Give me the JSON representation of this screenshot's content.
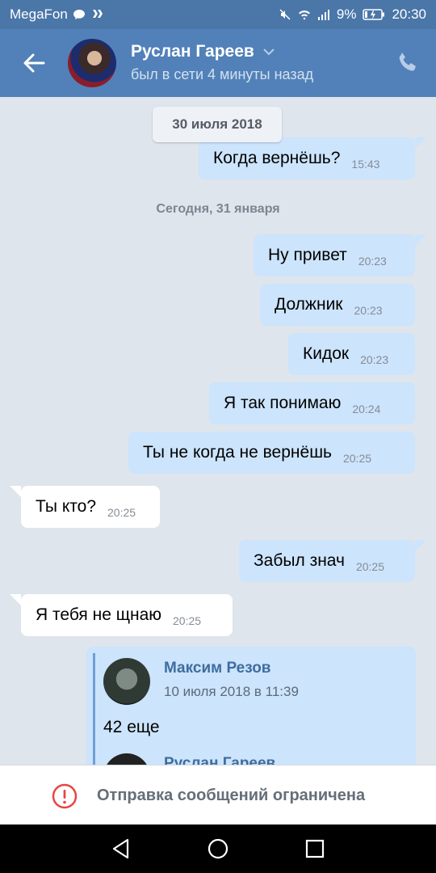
{
  "statusbar": {
    "carrier": "MegaFon",
    "battery": "9%",
    "time": "20:30",
    "icons": [
      "chat-bubble-icon",
      "vk-flag-icon",
      "mute-icon",
      "wifi-icon",
      "signal-icon",
      "battery-icon"
    ]
  },
  "header": {
    "contact_name": "Руслан Гареев",
    "contact_status": "был в сети 4 минуты назад",
    "icons": [
      "back-arrow-icon",
      "chevron-down-icon",
      "phone-icon"
    ]
  },
  "chat": {
    "date_pill": "30 июля 2018",
    "date_separator": "Сегодня, 31 января",
    "messages": [
      {
        "dir": "out",
        "text": "Когда вернёшь?",
        "time": "15:43"
      },
      {
        "dir": "out",
        "text": "Ну привет",
        "time": "20:23"
      },
      {
        "dir": "out",
        "text": "Должник",
        "time": "20:23"
      },
      {
        "dir": "out",
        "text": "Кидок",
        "time": "20:23"
      },
      {
        "dir": "out",
        "text": "Я так понимаю",
        "time": "20:24"
      },
      {
        "dir": "out",
        "text": "Ты не когда не вернёшь",
        "time": "20:25"
      },
      {
        "dir": "in",
        "text": "Ты кто?",
        "time": "20:25"
      },
      {
        "dir": "out",
        "text": "Забыл знач",
        "time": "20:25"
      },
      {
        "dir": "in",
        "text": "Я тебя не щнаю",
        "time": "20:25"
      }
    ],
    "forwarded": {
      "author": "Максим Резов",
      "date": "10 июля 2018 в 11:39",
      "text": "42 еще",
      "nested_author": "Руслан Гареев"
    }
  },
  "restriction": {
    "text": "Отправка сообщений ограничена",
    "icon": "exclamation-circle-icon"
  },
  "navbar": {
    "icons": [
      "back-triangle-icon",
      "home-circle-icon",
      "recents-square-icon"
    ]
  },
  "colors": {
    "header": "#5181b8",
    "statusbar": "#4a76a8",
    "chat_bg": "#dfe5ec",
    "bubble_out": "#cce4fc",
    "bubble_in": "#ffffff",
    "alert": "#e64646"
  }
}
